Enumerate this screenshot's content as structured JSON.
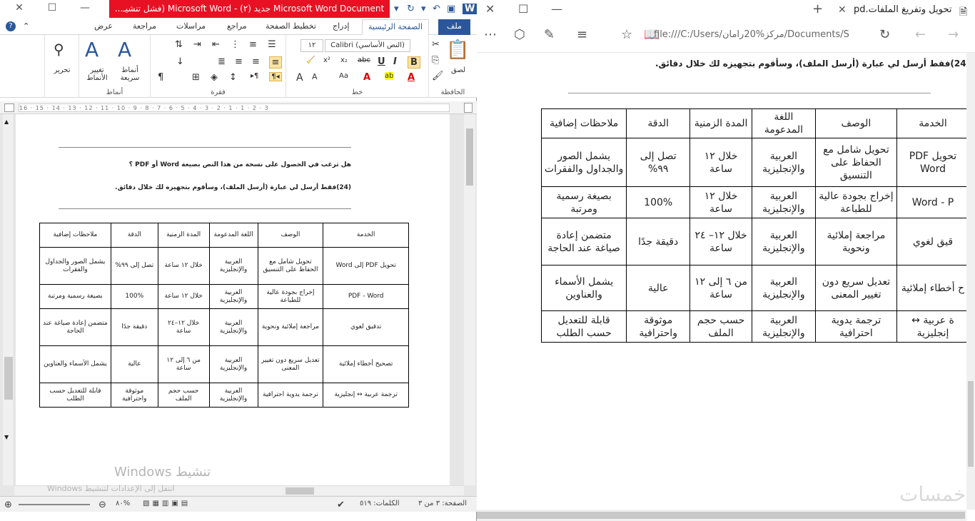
{
  "word": {
    "title_bar": {
      "title": "Microsoft Word Document جديد (٢) - Microsoft Word (فشل تنشيـ...",
      "close": "✕",
      "maximize": "☐",
      "minimize": "—"
    },
    "tabs": [
      "ملف",
      "الصفحة الرئيسية",
      "إدراج",
      "تخطيط الصفحة",
      "مراجع",
      "مراسلات",
      "مراجعة",
      "عرض"
    ],
    "ribbon": {
      "groups": {
        "clipboard": "الحافظة",
        "font": "خط",
        "paragraph": "فقرة",
        "styles": "أنماط",
        "editing": ""
      },
      "paste": "لصق",
      "font_name": "(النص الأساسي) Calibri",
      "font_size": "١٢",
      "quick_styles": "أنماط سريعة",
      "change_styles": "تغيير الأنماط",
      "editing_label": "تحرير"
    },
    "ruler_text": "16 · 15 · 14 · 13 · 12 · 11 · 10 · 9 · 8 · 7 · 6 · 5 · 4 · 3 · 2 · 1 · 1 · 2 · 3",
    "document": {
      "question": "هل ترغب في الحصول على نسخة من هذا النص بصيغة Word أو PDF ؟",
      "instruction": "(24)فقط أرسل لي عبارة (أرسل الملف)، وسأقوم بتجهيزه لك خلال دقائق.",
      "table": {
        "headers": [
          "الخدمة",
          "الوصف",
          "اللغة المدعومة",
          "المدة الزمنية",
          "الدقة",
          "ملاحظات إضافية"
        ],
        "rows": [
          [
            "تحويل PDF إلى Word",
            "تحويل شامل مع الحفاظ على التنسيق",
            "العربية والإنجليزية",
            "خلال ١٢ ساعة",
            "تصل إلى ٩٩%",
            "يشمل الصور والجداول والفقرات"
          ],
          [
            "PDF - Word",
            "إخراج بجودة عالية للطباعة",
            "العربية والإنجليزية",
            "خلال ١٢ ساعة",
            "100%",
            "بصيغة رسمية ومرتبة"
          ],
          [
            "تدقيق لغوي",
            "مراجعة إملائية ونحوية",
            "العربية والإنجليزية",
            "خلال ١٢–٢٤ ساعة",
            "دقيقة جدًا",
            "متضمن إعادة صياغة عند الحاجة"
          ],
          [
            "تصحيح أخطاء إملائية",
            "تعديل سريع دون تغيير المعنى",
            "العربية والإنجليزية",
            "من ٦ إلى ١٢ ساعة",
            "عالية",
            "يشمل الأسماء والعناوين"
          ],
          [
            "ترجمة عربية ↔ إنجليزية",
            "ترجمة يدوية احترافية",
            "العربية والإنجليزية",
            "حسب حجم الملف",
            "موثوقة واحترافية",
            "قابلة للتعديل حسب الطلب"
          ]
        ]
      }
    },
    "watermark": "تنشيط Windows",
    "watermark_sub": "انتقل إلى الإعدادات لتنشيط Windows",
    "status": {
      "page": "الصفحة: ٣ من ٣",
      "words": "الكلمات: ٥١٩",
      "zoom": "%٨٠"
    }
  },
  "edge": {
    "tab_title": "تحويل وتفريغ الملفات.pd",
    "tab_close": "✕",
    "new_tab": "+",
    "address": "file:///C:/Users/مركز%20رامان/Documents/S",
    "document": {
      "instruction": "(24)فقط أرسل لي عبارة (أرسل الملف)، وسأقوم بتجهيزه لك خلال دقائق.",
      "table": {
        "headers": [
          "الخدمة",
          "الوصف",
          "اللغة المدعومة",
          "المدة الزمنية",
          "الدقة",
          "ملاحظات إضافية"
        ],
        "rows": [
          [
            "تحويل PDF Word",
            "تحويل شامل مع الحفاظ على التنسيق",
            "العربية والإنجليزية",
            "خلال ١٢ ساعة",
            "تصل إلى ٩٩%",
            "يشمل الصور والجداول والفقرات"
          ],
          [
            "Word - P",
            "إخراج بجودة عالية للطباعة",
            "العربية والإنجليزية",
            "خلال ١٢ ساعة",
            "100%",
            "بصيغة رسمية ومرتبة"
          ],
          [
            "قيق لغوي",
            "مراجعة إملائية ونحوية",
            "العربية والإنجليزية",
            "خلال ١٢– ٢٤ ساعة",
            "دقيقة جدًا",
            "متضمن إعادة صياغة عند الحاجة"
          ],
          [
            "ح أخطاء إملائية",
            "تعديل سريع دون تغيير المعنى",
            "العربية والإنجليزية",
            "من ٦ إلى ١٢ ساعة",
            "عالية",
            "يشمل الأسماء والعناوين"
          ],
          [
            "ة عربية ↔ إنجليزية",
            "ترجمة يدوية احترافية",
            "العربية والإنجليزية",
            "حسب حجم الملف",
            "موثوقة واحترافية",
            "قابلة للتعديل حسب الطلب"
          ]
        ]
      }
    },
    "watermark": "خمسات"
  }
}
